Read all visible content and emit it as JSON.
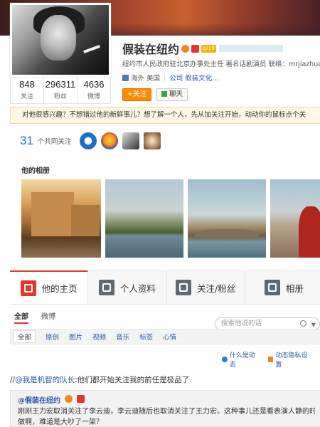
{
  "profile": {
    "name": "假装在纽约",
    "level": "LV19",
    "description": "纽约市人民政府驻北京办事处主任 著名话剧演员 联络：mrjiazhuang",
    "location": "海外 美国",
    "company": "公司 假装文化..."
  },
  "stats": [
    {
      "value": "848",
      "label": "关注"
    },
    {
      "value": "296311",
      "label": "粉丝"
    },
    {
      "value": "4636",
      "label": "微博"
    }
  ],
  "buttons": {
    "follow": "+关注",
    "chat": "聊天"
  },
  "invite": {
    "text": "对他很感兴趣？不想错过他的新鲜事儿？想了解一个人，先从加关注开始，动动你的鼠标点个关"
  },
  "common": {
    "count": "31",
    "label": "个共同关注"
  },
  "album": {
    "title": "他的相册"
  },
  "tabs": [
    {
      "label": "他的主页",
      "icon": "home-icon"
    },
    {
      "label": "个人资料",
      "icon": "person-icon"
    },
    {
      "label": "关注/粉丝",
      "icon": "people-icon"
    },
    {
      "label": "相册",
      "icon": "camera-icon"
    }
  ],
  "subnav": [
    "全部",
    "微博"
  ],
  "search": {
    "placeholder": "搜索他说的话"
  },
  "filters": [
    "全部",
    "原创",
    "图片",
    "视频",
    "音乐",
    "标签",
    "心情"
  ],
  "links": {
    "what": "什么是动态",
    "privacy": "动态隐私设置"
  },
  "post": {
    "prefix": "//",
    "mention": "@我是机智的队长",
    "text": ":他们都开始关注我的前任是极品了",
    "repost_author": "@假装在纽约",
    "repost_line1": "刚刚王力宏取消关注了李云迪，李云迪随后也取消关注了王力宏。这种事儿还是看表演人静的时候",
    "repost_line2": "做啊，难道是大吵了一架？"
  },
  "colors": {
    "accent_orange": "#ff8b00",
    "tab_red": "#e7352c",
    "link_blue": "#2a5aa6"
  }
}
